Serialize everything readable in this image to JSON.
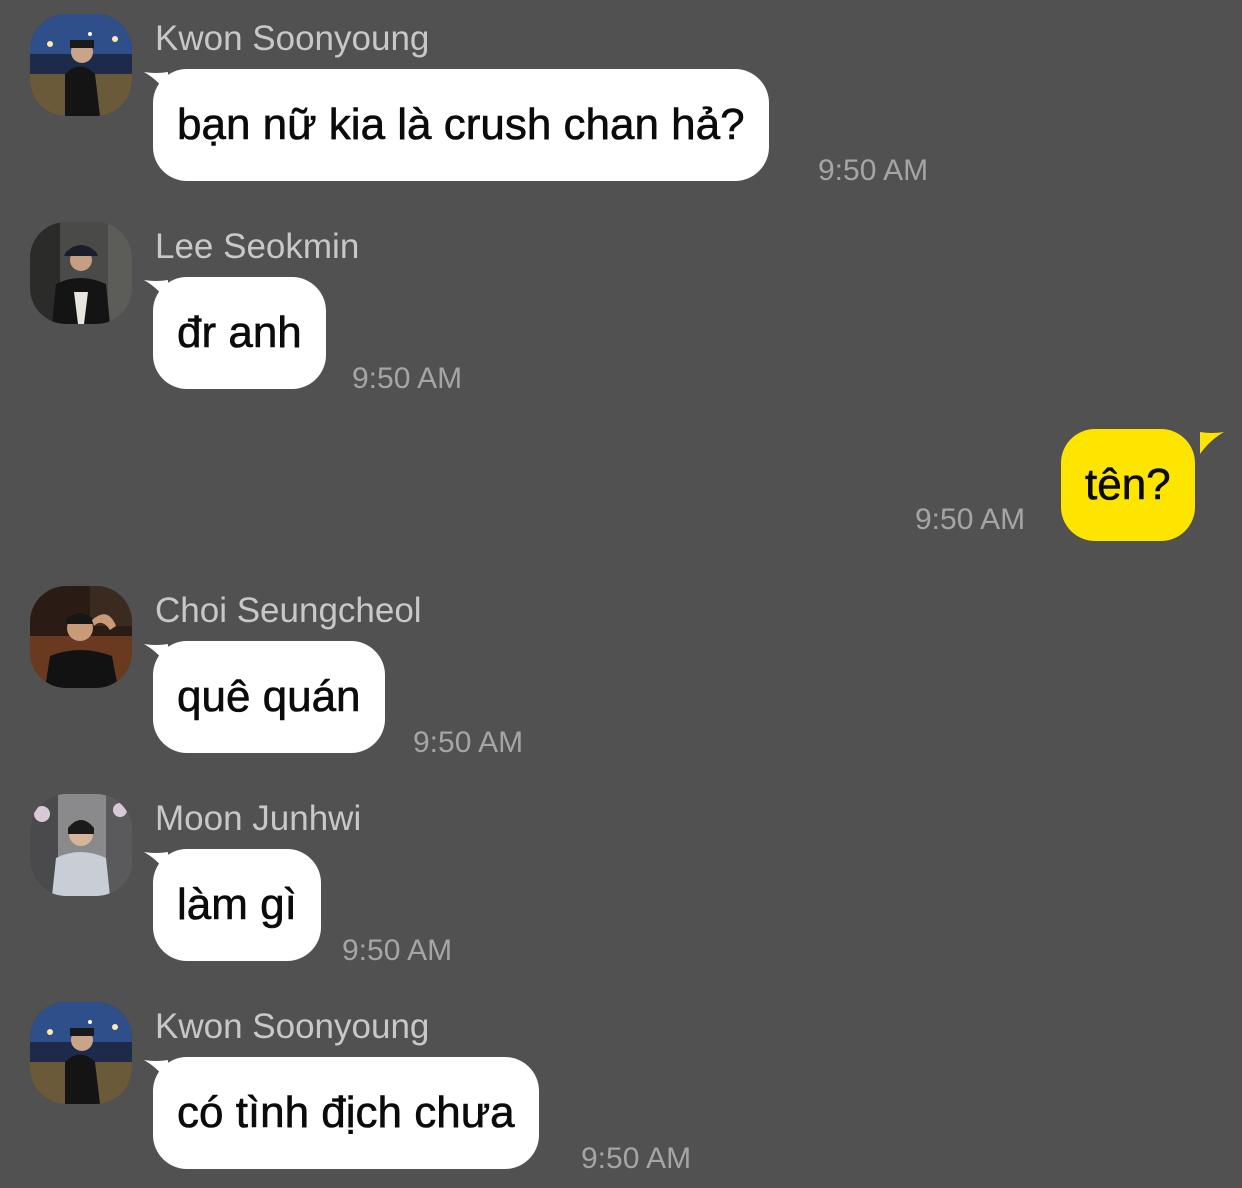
{
  "colors": {
    "background": "#525152",
    "incoming_bubble": "#ffffff",
    "outgoing_bubble": "#fee500",
    "sender_name": "#c9c8c9",
    "timestamp": "#a6a5a6"
  },
  "messages": [
    {
      "sender": "Kwon Soonyoung",
      "avatar_icon": "avatar-kwon-soonyoung",
      "text": "bạn nữ kia là crush chan hả?",
      "time": "9:50 AM"
    },
    {
      "sender": "Lee Seokmin",
      "avatar_icon": "avatar-lee-seokmin",
      "text": "đr anh",
      "time": "9:50 AM"
    },
    {
      "direction": "outgoing",
      "text": "tên?",
      "time": "9:50 AM"
    },
    {
      "sender": "Choi Seungcheol",
      "avatar_icon": "avatar-choi-seungcheol",
      "text": "quê quán",
      "time": "9:50 AM"
    },
    {
      "sender": "Moon Junhwi",
      "avatar_icon": "avatar-moon-junhwi",
      "text": "làm gì",
      "time": "9:50 AM"
    },
    {
      "sender": "Kwon Soonyoung",
      "avatar_icon": "avatar-kwon-soonyoung",
      "text": "có tình địch chưa",
      "time": "9:50 AM"
    }
  ]
}
